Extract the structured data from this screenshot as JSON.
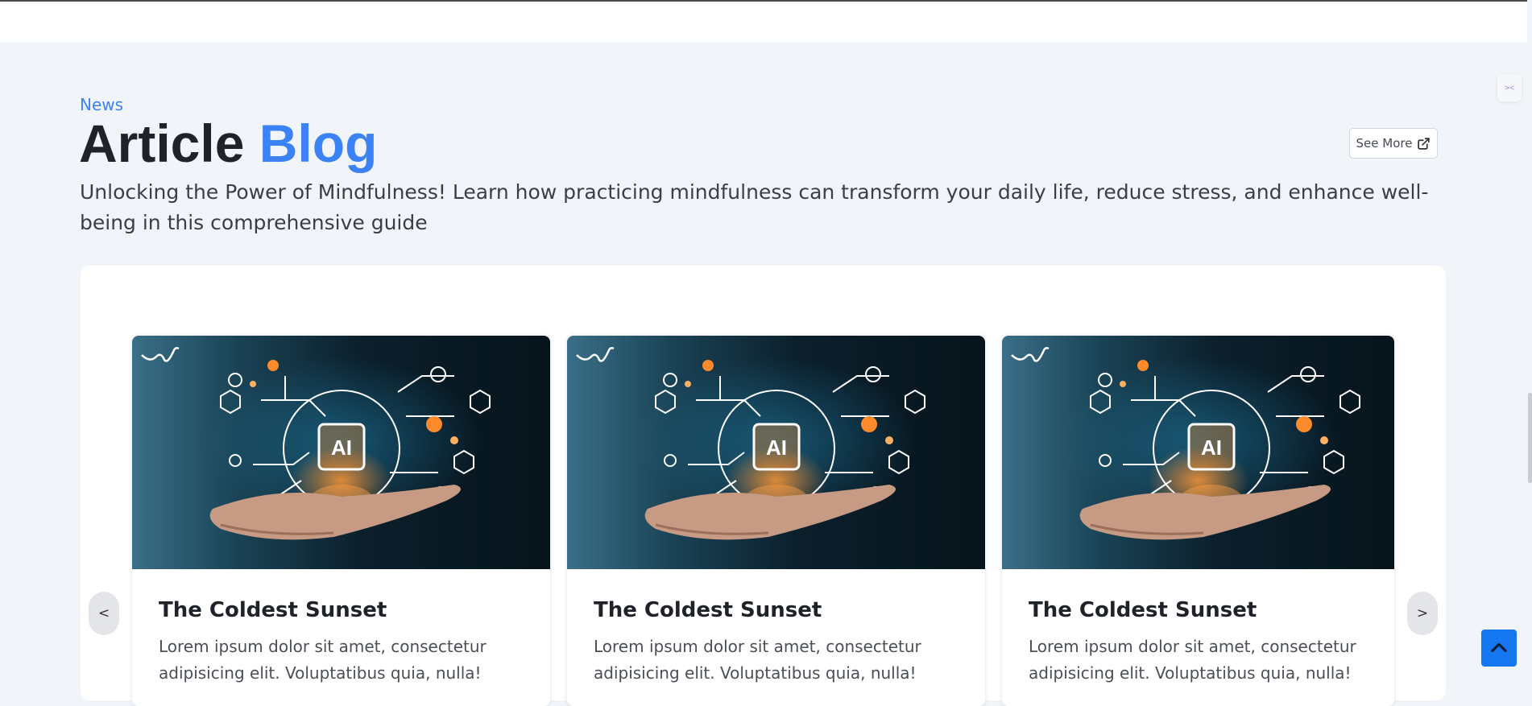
{
  "header": {
    "eyebrow": "News",
    "title_main": "Article",
    "title_accent": "Blog",
    "subtitle": "Unlocking the Power of Mindfulness! Learn how practicing mindfulness can transform your daily life, reduce stress, and enhance well-being in this comprehensive guide",
    "see_more_label": "See More",
    "see_more_icon": "external-link-icon"
  },
  "carousel": {
    "prev_label": "<",
    "next_label": ">",
    "cards": [
      {
        "image_label": "AI",
        "title": "The Coldest Sunset",
        "text": "Lorem ipsum dolor sit amet, consectetur adipisicing elit. Voluptatibus quia, nulla!"
      },
      {
        "image_label": "AI",
        "title": "The Coldest Sunset",
        "text": "Lorem ipsum dolor sit amet, consectetur adipisicing elit. Voluptatibus quia, nulla!"
      },
      {
        "image_label": "AI",
        "title": "The Coldest Sunset",
        "text": "Lorem ipsum dolor sit amet, consectetur adipisicing elit. Voluptatibus quia, nulla!"
      }
    ]
  },
  "icons": {
    "back_to_top": "chevron-up-icon",
    "side_widget": "code-icon"
  },
  "colors": {
    "accent": "#3b82f6",
    "page_bg": "#f1f4f9",
    "back_to_top_bg": "#1577f0"
  }
}
